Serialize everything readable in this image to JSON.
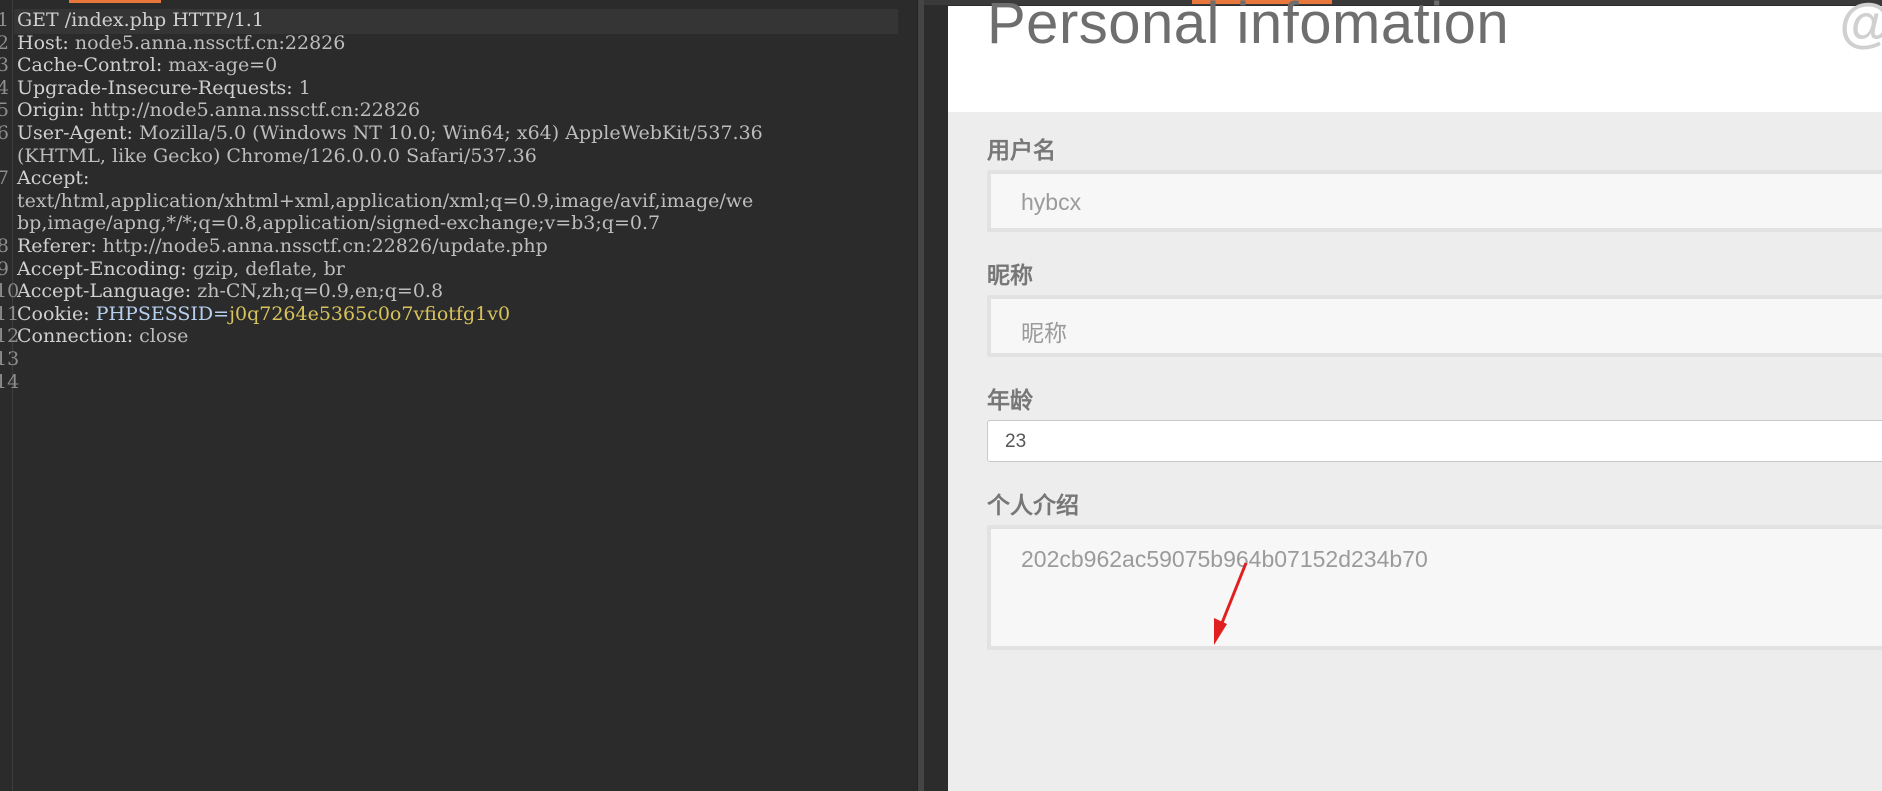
{
  "request": {
    "line_numbers": [
      "1",
      "2",
      "3",
      "4",
      "5",
      "6",
      "",
      "7",
      "",
      "",
      "8",
      "9",
      "10",
      "11",
      "12",
      "13",
      "14"
    ],
    "lines": [
      {
        "name": "GET /index.php HTTP/1.1",
        "value": ""
      },
      {
        "name": "Host:",
        "value": " node5.anna.nssctf.cn:22826"
      },
      {
        "name": "Cache-Control:",
        "value": " max-age=0"
      },
      {
        "name": "Upgrade-Insecure-Requests:",
        "value": " 1"
      },
      {
        "name": "Origin:",
        "value": " http://node5.anna.nssctf.cn:22826"
      },
      {
        "name": "User-Agent:",
        "value": " Mozilla/5.0 (Windows NT 10.0; Win64; x64) AppleWebKit/537.36"
      },
      {
        "name": "",
        "value": "(KHTML, like Gecko) Chrome/126.0.0.0 Safari/537.36"
      },
      {
        "name": "Accept:",
        "value": ""
      },
      {
        "name": "",
        "value": "text/html,application/xhtml+xml,application/xml;q=0.9,image/avif,image/we"
      },
      {
        "name": "",
        "value": "bp,image/apng,*/*;q=0.8,application/signed-exchange;v=b3;q=0.7"
      },
      {
        "name": "Referer:",
        "value": " http://node5.anna.nssctf.cn:22826/update.php"
      },
      {
        "name": "Accept-Encoding:",
        "value": " gzip, deflate, br"
      },
      {
        "name": "Accept-Language:",
        "value": " zh-CN,zh;q=0.9,en;q=0.8"
      },
      {
        "name": "Cookie:",
        "value": ""
      },
      {
        "name": "Connection:",
        "value": " close"
      },
      {
        "name": "",
        "value": ""
      },
      {
        "name": "",
        "value": ""
      }
    ],
    "cookie": {
      "name": "PHPSESSID=",
      "value": "j0q7264e5365c0o7vfiotfg1v0"
    }
  },
  "page": {
    "title": "Personal infomation",
    "corner_mark": "@",
    "fields": {
      "username": {
        "label": "用户名",
        "value": "hybcx"
      },
      "nickname": {
        "label": "昵称",
        "placeholder": "昵称"
      },
      "age": {
        "label": "年龄",
        "value": "23"
      },
      "bio": {
        "label": "个人介绍",
        "value": "202cb962ac59075b964b07152d234b70"
      }
    }
  },
  "colors": {
    "accent": "#e8773c",
    "arrow": "#e02020"
  }
}
